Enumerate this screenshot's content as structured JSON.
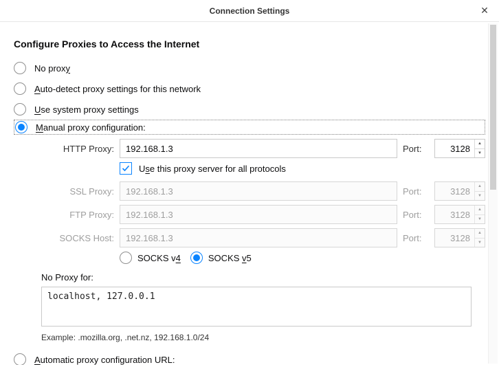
{
  "titlebar": {
    "title": "Connection Settings",
    "close_glyph": "✕"
  },
  "heading": "Configure Proxies to Access the Internet",
  "options": {
    "none": {
      "pre": "No prox",
      "u": "y",
      "post": ""
    },
    "auto_detect": {
      "pre": "",
      "u": "A",
      "post": "uto-detect proxy settings for this network"
    },
    "system": {
      "pre": "",
      "u": "U",
      "post": "se system proxy settings"
    },
    "manual": {
      "pre": "",
      "u": "M",
      "post": "anual proxy configuration:"
    },
    "auto_url": {
      "pre": "",
      "u": "A",
      "post": "utomatic proxy configuration URL:"
    }
  },
  "proxy": {
    "http": {
      "label_pre": "HTTP Pro",
      "label_u": "x",
      "label_post": "y:",
      "host": "192.168.1.3",
      "port_label_u": "P",
      "port_label_post": "ort:",
      "port": "3128"
    },
    "use_same": {
      "pre": "U",
      "u": "s",
      "post": "e this proxy server for all protocols"
    },
    "ssl": {
      "label_pre": "SS",
      "label_u": "L",
      "label_post": " Proxy:",
      "host": "192.168.1.3",
      "port_label_pre": "P",
      "port_label_u": "o",
      "port_label_post": "rt:",
      "port": "3128"
    },
    "ftp": {
      "label_pre": "",
      "label_u": "F",
      "label_post": "TP Proxy:",
      "host": "192.168.1.3",
      "port_label_pre": "Po",
      "port_label_u": "r",
      "port_label_post": "t:",
      "port": "3128"
    },
    "socks": {
      "label_pre": "SO",
      "label_u": "C",
      "label_post": "KS Host:",
      "host": "192.168.1.3",
      "port_label_pre": "Por",
      "port_label_u": "t",
      "port_label_post": ":",
      "port": "3128"
    },
    "socks_v4": {
      "pre": "SOCKS v",
      "u": "4",
      "post": ""
    },
    "socks_v5": {
      "pre": "SOCKS ",
      "u": "v",
      "post": "5"
    }
  },
  "no_proxy": {
    "label_u": "N",
    "label_post": "o Proxy for:",
    "value": "localhost, 127.0.0.1",
    "example": "Example: .mozilla.org, .net.nz, 192.168.1.0/24"
  }
}
